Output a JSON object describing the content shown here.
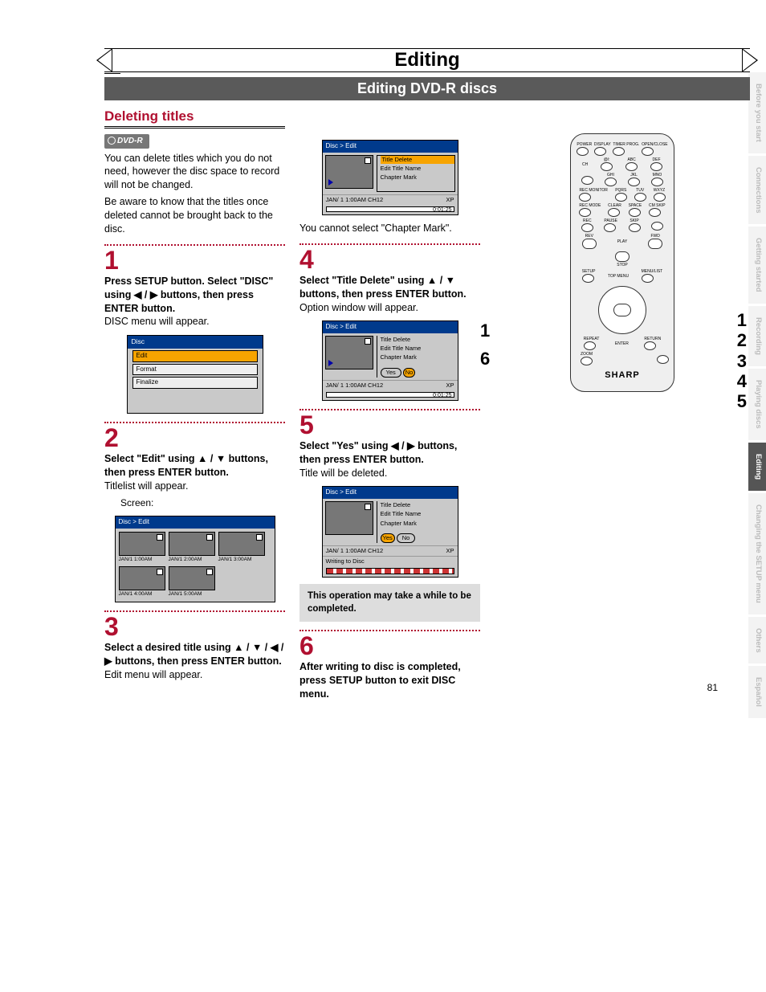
{
  "page": {
    "title": "Editing",
    "subtitle": "Editing DVD-R discs",
    "section": "Deleting titles",
    "badge": "DVD-R",
    "number": "81"
  },
  "intro": {
    "p1": "You can delete titles which you do not need, however the disc space to record will not be changed.",
    "p2": "Be aware to know that the titles once deleted cannot be brought back to the disc."
  },
  "steps": {
    "s1": {
      "num": "1",
      "bold": "Press SETUP button. Select \"DISC\" using ◀ / ▶ buttons, then press ENTER button.",
      "plain": "DISC menu will appear."
    },
    "s2": {
      "num": "2",
      "bold": "Select \"Edit\" using ▲ / ▼ buttons, then press ENTER button.",
      "plain": "Titlelist will appear.",
      "screen_label": "Screen:"
    },
    "s3": {
      "num": "3",
      "bold": "Select a desired title using ▲ / ▼ / ◀ / ▶ buttons, then press ENTER button.",
      "plain": "Edit menu will appear."
    },
    "s3b": {
      "note": "You cannot select \"Chapter Mark\"."
    },
    "s4": {
      "num": "4",
      "bold": "Select \"Title Delete\" using ▲ / ▼ buttons, then press ENTER button.",
      "plain": "Option window will appear."
    },
    "s5": {
      "num": "5",
      "bold": "Select \"Yes\" using ◀ / ▶ buttons, then press ENTER button.",
      "plain": "Title will be deleted."
    },
    "s6": {
      "num": "6",
      "bold": "After writing to disc is completed, press SETUP button to exit DISC menu."
    }
  },
  "note_box": "This operation may take a while to be completed.",
  "osd": {
    "breadcrumb": "Disc > Edit",
    "menu": {
      "item1": "Title Delete",
      "item2": "Edit Title Name",
      "item3": "Chapter Mark"
    },
    "status": {
      "left": "JAN/ 1   1:00AM  CH12",
      "right": "XP"
    },
    "time": "0:01:25",
    "yes": "Yes",
    "no": "No",
    "writing": "Writing to Disc"
  },
  "disc_menu": {
    "header": "Disc",
    "edit": "Edit",
    "format": "Format",
    "finalize": "Finalize"
  },
  "titlelist": {
    "header": "Disc > Edit",
    "cells": [
      "JAN/1  1:00AM",
      "JAN/1  2:00AM",
      "JAN/1  3:00AM",
      "JAN/1  4:00AM",
      "JAN/1  5:00AM"
    ]
  },
  "remote": {
    "labels": {
      "power": "POWER",
      "display": "DISPLAY",
      "timer": "TIMER PROG.",
      "open": "OPEN/CLOSE",
      "ch": "CH",
      "rec_monitor": "REC MONITOR",
      "rec_mode": "REC MODE",
      "clear": "CLEAR",
      "space": "SPACE",
      "cmskip": "CM SKIP",
      "rec": "REC",
      "pause": "PAUSE",
      "skip": "SKIP",
      "play": "PLAY",
      "stop": "STOP",
      "rev": "REV",
      "fwd": "FWD",
      "setup": "SETUP",
      "topmenu": "TOP MENU",
      "menulist": "MENU/LIST",
      "repeat": "REPEAT",
      "enter": "ENTER",
      "return": "RETURN",
      "zoom": "ZOOM"
    },
    "numpad": {
      "r1a": "@/:",
      "r1b": "ABC",
      "r1c": "DEF",
      "r2a": "GHI",
      "r2b": "JKL",
      "r2c": "MNO",
      "r3a": "PQRS",
      "r3b": "TUV",
      "r3c": "WXYZ"
    },
    "brand": "SHARP"
  },
  "callouts": {
    "left1": "1",
    "left6": "6",
    "r1": "1",
    "r2": "2",
    "r3": "3",
    "r4": "4",
    "r5": "5"
  },
  "tabs": {
    "t1": "Before you start",
    "t2": "Connections",
    "t3": "Getting started",
    "t4": "Recording",
    "t5": "Playing discs",
    "t6": "Editing",
    "t7": "Changing the SETUP menu",
    "t8": "Others",
    "t9": "Español"
  }
}
